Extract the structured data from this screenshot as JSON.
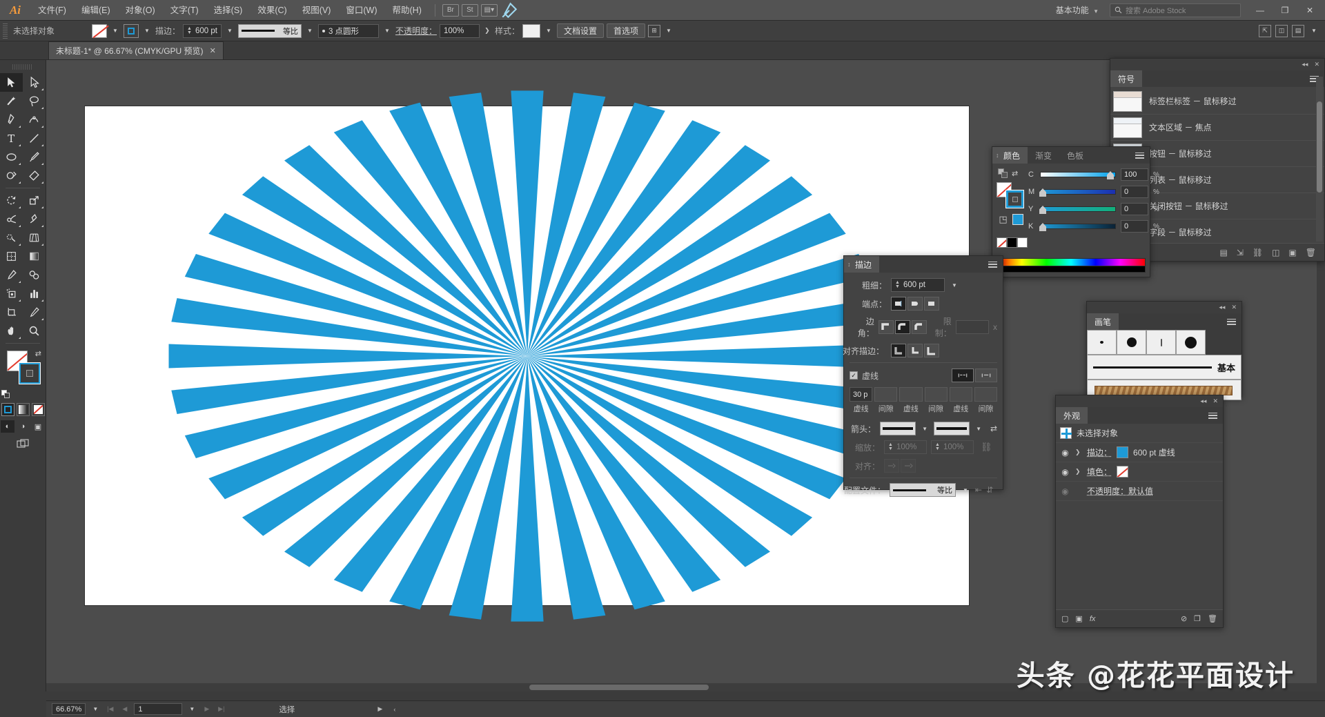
{
  "app": {
    "name": "Adobe Illustrator",
    "logo": "Ai",
    "workspace": "基本功能",
    "stock_placeholder": "搜索 Adobe Stock",
    "search_icon": "search-icon"
  },
  "menu": {
    "items": [
      "文件(F)",
      "编辑(E)",
      "对象(O)",
      "文字(T)",
      "选择(S)",
      "效果(C)",
      "视图(V)",
      "窗口(W)",
      "帮助(H)"
    ],
    "window_controls": [
      "—",
      "❐",
      "✕"
    ]
  },
  "control_bar": {
    "selection_status": "未选择对象",
    "stroke_label": "描边：",
    "stroke_weight": "600 pt",
    "profile_name": "等比",
    "brush_def": "3 点圆形",
    "opacity_label": "不透明度：",
    "opacity_value": "100%",
    "style_label": "样式：",
    "doc_setup": "文档设置",
    "preferences": "首选项"
  },
  "document_tab": {
    "title": "未标题-1* @ 66.67% (CMYK/GPU 预览)",
    "close": "✕"
  },
  "toolbar": {
    "tools": [
      {
        "name": "selection-tool",
        "active": true
      },
      {
        "name": "direct-selection-tool",
        "active": false
      },
      {
        "name": "magic-wand-tool",
        "active": false
      },
      {
        "name": "lasso-tool",
        "active": false
      },
      {
        "name": "pen-tool",
        "active": false
      },
      {
        "name": "curvature-tool",
        "active": false
      },
      {
        "name": "type-tool",
        "active": false
      },
      {
        "name": "line-segment-tool",
        "active": false
      },
      {
        "name": "ellipse-tool",
        "active": false
      },
      {
        "name": "paintbrush-tool",
        "active": false
      },
      {
        "name": "shaper-tool",
        "active": false
      },
      {
        "name": "eraser-tool",
        "active": false
      },
      {
        "name": "rotate-tool",
        "active": false
      },
      {
        "name": "scale-tool",
        "active": false
      },
      {
        "name": "width-tool",
        "active": false
      },
      {
        "name": "free-transform-tool",
        "active": false
      },
      {
        "name": "shape-builder-tool",
        "active": false
      },
      {
        "name": "perspective-grid-tool",
        "active": false
      },
      {
        "name": "mesh-tool",
        "active": false
      },
      {
        "name": "gradient-tool",
        "active": false
      },
      {
        "name": "eyedropper-tool",
        "active": false
      },
      {
        "name": "blend-tool",
        "active": false
      },
      {
        "name": "symbol-sprayer-tool",
        "active": false
      },
      {
        "name": "column-graph-tool",
        "active": false
      },
      {
        "name": "artboard-tool",
        "active": false
      },
      {
        "name": "slice-tool",
        "active": false
      },
      {
        "name": "hand-tool",
        "active": false
      },
      {
        "name": "zoom-tool",
        "active": false
      }
    ],
    "fill_color": "none",
    "stroke_color": "#1e9ad6",
    "paint_modes": [
      "color-mode",
      "gradient-mode",
      "none-mode"
    ],
    "draw_modes": [
      "draw-normal",
      "draw-behind",
      "draw-inside"
    ],
    "screen_mode": "screen-mode-toggle"
  },
  "artwork": {
    "background": "#ffffff",
    "ray_color": "#1e9ad6",
    "ray_count": 36,
    "description": "radial burst of dashed stroke rays"
  },
  "panels": {
    "stroke": {
      "tab": "描边",
      "weight_label": "粗细：",
      "weight_value": "600 pt",
      "cap_label": "端点：",
      "corner_label": "边角：",
      "limit_label": "限制：",
      "limit_unit": "x",
      "align_label": "对齐描边：",
      "dashed_label": "虚线",
      "dashed_checked": true,
      "dash_fields": [
        {
          "value": "30 p",
          "caption": "虚线"
        },
        {
          "value": "",
          "caption": "间隙"
        },
        {
          "value": "",
          "caption": "虚线"
        },
        {
          "value": "",
          "caption": "间隙"
        },
        {
          "value": "",
          "caption": "虚线"
        },
        {
          "value": "",
          "caption": "间隙"
        }
      ],
      "arrow_label": "箭头：",
      "scale_label": "缩放：",
      "scale_start": "100%",
      "scale_end": "100%",
      "align_dash_label": "对齐：",
      "profile_label": "配置文件：",
      "profile_value": "等比"
    },
    "color": {
      "tabs": [
        "颜色",
        "渐变",
        "色板"
      ],
      "active_tab": "颜色",
      "sliders": [
        {
          "letter": "C",
          "value": "100",
          "unit": "%",
          "pct": 100
        },
        {
          "letter": "M",
          "value": "0",
          "unit": "%",
          "pct": 0
        },
        {
          "letter": "Y",
          "value": "0",
          "unit": "%",
          "pct": 0
        },
        {
          "letter": "K",
          "value": "0",
          "unit": "%",
          "pct": 0
        }
      ],
      "current_color": "#1e9ad6"
    },
    "symbols": {
      "tab": "符号",
      "items": [
        "标签栏标签 － 鼠标移过",
        "文本区域 － 焦点",
        "按钮 － 鼠标移过",
        "列表 － 鼠标移过",
        "关闭按钮 － 鼠标移过",
        "字段 － 鼠标移过"
      ]
    },
    "brushes": {
      "tab": "画笔",
      "basic_label": "基本"
    },
    "appearance": {
      "tab": "外观",
      "target": "未选择对象",
      "rows": [
        {
          "label": "描边：",
          "value": "600 pt 虚线",
          "swatch": "blue"
        },
        {
          "label": "填色：",
          "value": "",
          "swatch": "none"
        },
        {
          "label": "不透明度：默认值",
          "value": "",
          "swatch": "text"
        }
      ]
    }
  },
  "status_bar": {
    "zoom": "66.67%",
    "page": "1",
    "current_tool": "选择"
  },
  "watermark": {
    "text": "头条 @花花平面设计"
  }
}
